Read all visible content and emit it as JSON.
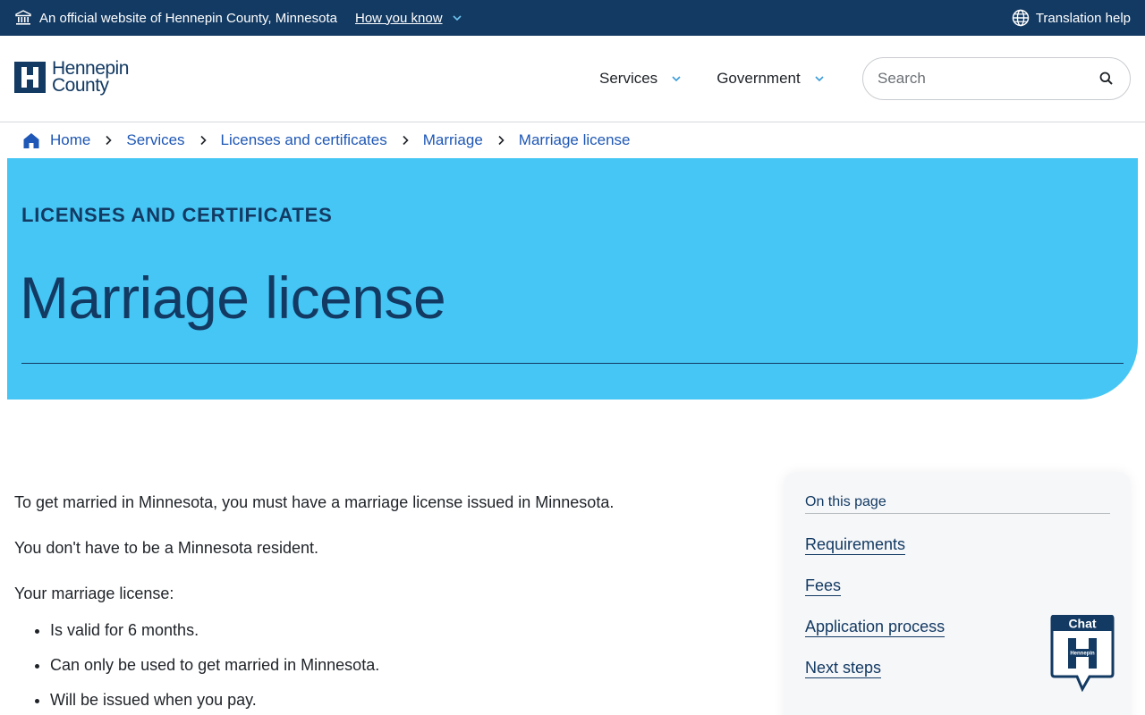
{
  "banner": {
    "official_text": "An official website of Hennepin County, Minnesota",
    "how_you_know": "How you know",
    "translation_help": "Translation help"
  },
  "header": {
    "logo_line1": "Hennepin",
    "logo_line2": "County",
    "nav": [
      {
        "label": "Services"
      },
      {
        "label": "Government"
      }
    ],
    "search_placeholder": "Search"
  },
  "breadcrumb": [
    "Home",
    "Services",
    "Licenses and certificates",
    "Marriage",
    "Marriage license"
  ],
  "hero": {
    "eyebrow": "LICENSES AND CERTIFICATES",
    "title": "Marriage license"
  },
  "content": {
    "paragraphs": [
      "To get married in Minnesota, you must have a marriage license issued in Minnesota.",
      "You don't have to be a Minnesota resident.",
      "Your marriage license:"
    ],
    "bullets": [
      "Is valid for 6 months.",
      "Can only be used to get married in Minnesota.",
      "Will be issued when you pay."
    ]
  },
  "toc": {
    "title": "On this page",
    "links": [
      "Requirements",
      "Fees",
      "Application process",
      "Next steps"
    ]
  },
  "chat": {
    "label": "Chat",
    "badge": "Hennepin"
  },
  "colors": {
    "navy": "#133a63",
    "hero_blue": "#45c6f4",
    "link_blue": "#1e57b5"
  }
}
